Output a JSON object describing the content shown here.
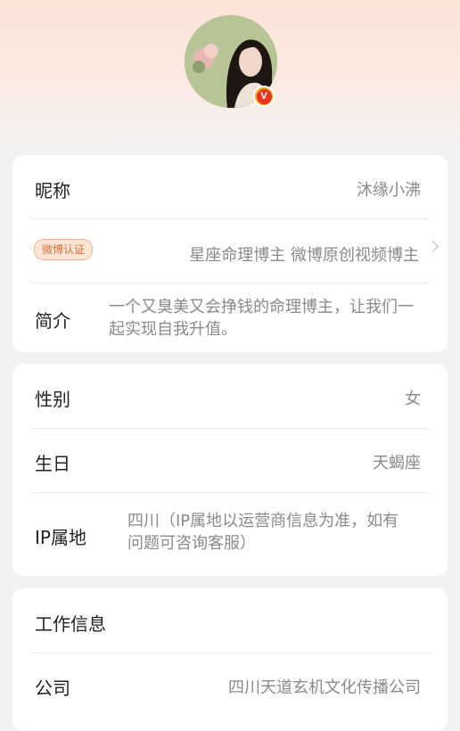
{
  "profile": {
    "avatar_icon": "avatar-photo",
    "verified_badge": "V"
  },
  "basic": {
    "nickname_label": "昵称",
    "nickname_value": "沐缘小沸",
    "verify_badge": "微博认证",
    "verify_value": "星座命理博主 微博原创视频博主",
    "intro_label": "简介",
    "intro_value": "一个又臭美又会挣钱的命理博主，让我们一起实现自我升值。"
  },
  "personal": {
    "gender_label": "性别",
    "gender_value": "女",
    "birthday_label": "生日",
    "birthday_value": "天蝎座",
    "ip_label": "IP属地",
    "ip_value": "四川（IP属地以运营商信息为准，如有问题可咨询客服）"
  },
  "work": {
    "section_title": "工作信息",
    "company_label": "公司",
    "company_value": "四川天道玄机文化传播公司"
  }
}
